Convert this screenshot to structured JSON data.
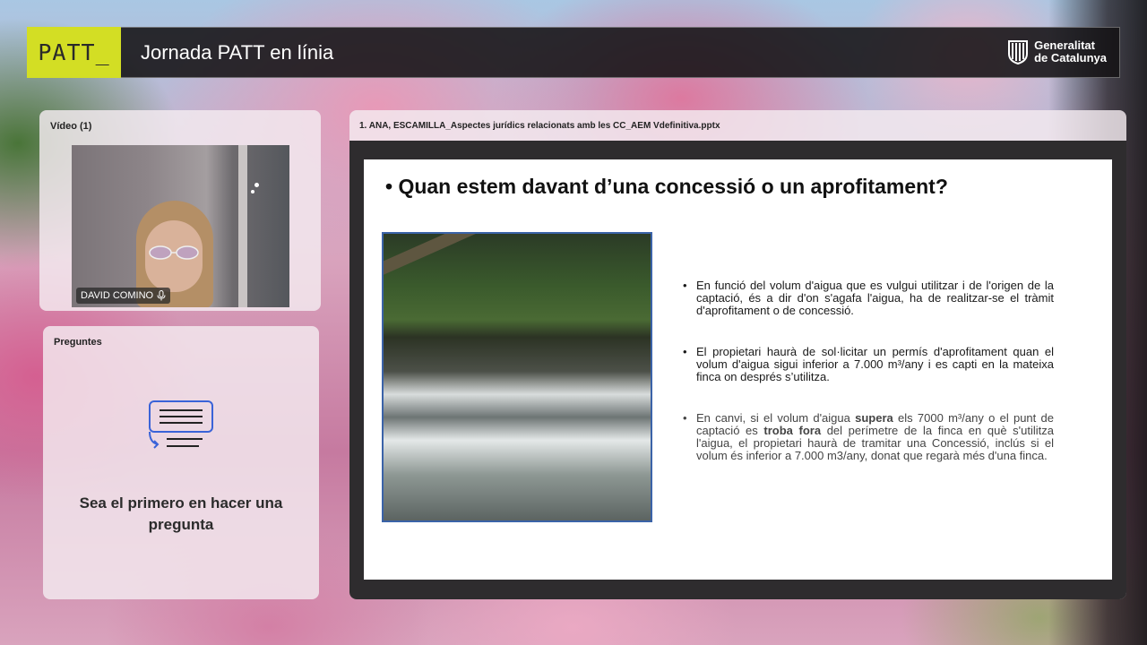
{
  "header": {
    "logo": "PATT_",
    "title": "Jornada PATT en línia",
    "org_line1": "Generalitat",
    "org_line2": "de Catalunya",
    "logo_bg_color": "#d3de24"
  },
  "video_panel": {
    "title": "Vídeo (1)",
    "participant_name": "DAVID COMINO",
    "mic_icon": "microphone-icon"
  },
  "questions_panel": {
    "title": "Preguntes",
    "empty_text": "Sea el primero en hacer una pregunta",
    "icon": "questions-list-icon"
  },
  "presentation": {
    "file_name": "1. ANA, ESCAMILLA_Aspectes jurídics relacionats amb les CC_AEM Vdefinitiva.pptx",
    "slide": {
      "title": "• Quan estem davant d’una concessió o un aprofitament?",
      "bullets": [
        {
          "text": "En funció del volum d'aigua que es vulgui utilitzar i de l'origen de la captació, és a dir d'on s'agafa l'aigua, ha de realitzar-se el tràmit d'aprofitament o de concessió."
        },
        {
          "text": "El propietari haurà de sol·licitar un permís d'aprofitament quan el volum d'aigua sigui inferior a 7.000 m³/any i es capti en la mateixa finca on després s’utilitza."
        },
        {
          "pre": "En canvi, si el volum d'aigua ",
          "bold1": "supera",
          "mid": " els 7000 m³/any o el punt de captació es ",
          "bold2": "troba fora",
          "post": " del perímetre de la finca en què s'utilitza l'aigua, el propietari haurà de tramitar una Concessió, inclús si el volum és inferior a 7.000 m3/any, donat que regarà més d'una finca."
        }
      ]
    }
  }
}
